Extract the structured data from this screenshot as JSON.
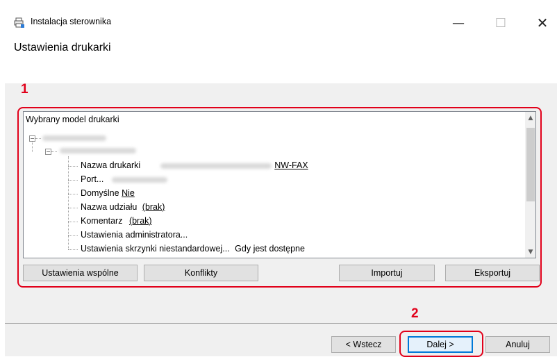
{
  "window": {
    "title": "Instalacja sterownika",
    "minimize_glyph": "—",
    "maximize_glyph": "☐",
    "close_glyph": "✕",
    "icon": "printer-icon"
  },
  "header": {
    "title": "Ustawienia drukarki"
  },
  "callouts": {
    "one": "1",
    "two": "2"
  },
  "tree": {
    "root_label": "Wybrany model drukarki",
    "items": [
      {
        "label": "Nazwa drukarki",
        "value": "NW-FAX"
      },
      {
        "label": "Port..."
      },
      {
        "label": "Domyślne",
        "value": "Nie"
      },
      {
        "label": "Nazwa udziału",
        "value": "(brak)"
      },
      {
        "label": "Komentarz",
        "value": "(brak)"
      },
      {
        "label": "Ustawienia administratora..."
      },
      {
        "label": "Ustawienia skrzynki niestandardowej...",
        "suffix": "Gdy jest dostępne"
      }
    ]
  },
  "panel_buttons": {
    "common": "Ustawienia wspólne",
    "conflicts": "Konflikty",
    "import": "Importuj",
    "export": "Eksportuj"
  },
  "footer_buttons": {
    "back": "< Wstecz",
    "next": "Dalej >",
    "cancel": "Anuluj"
  },
  "colors": {
    "callout": "#e1001a",
    "default_button_border": "#0078d7",
    "body_background": "#f0f0f0"
  }
}
